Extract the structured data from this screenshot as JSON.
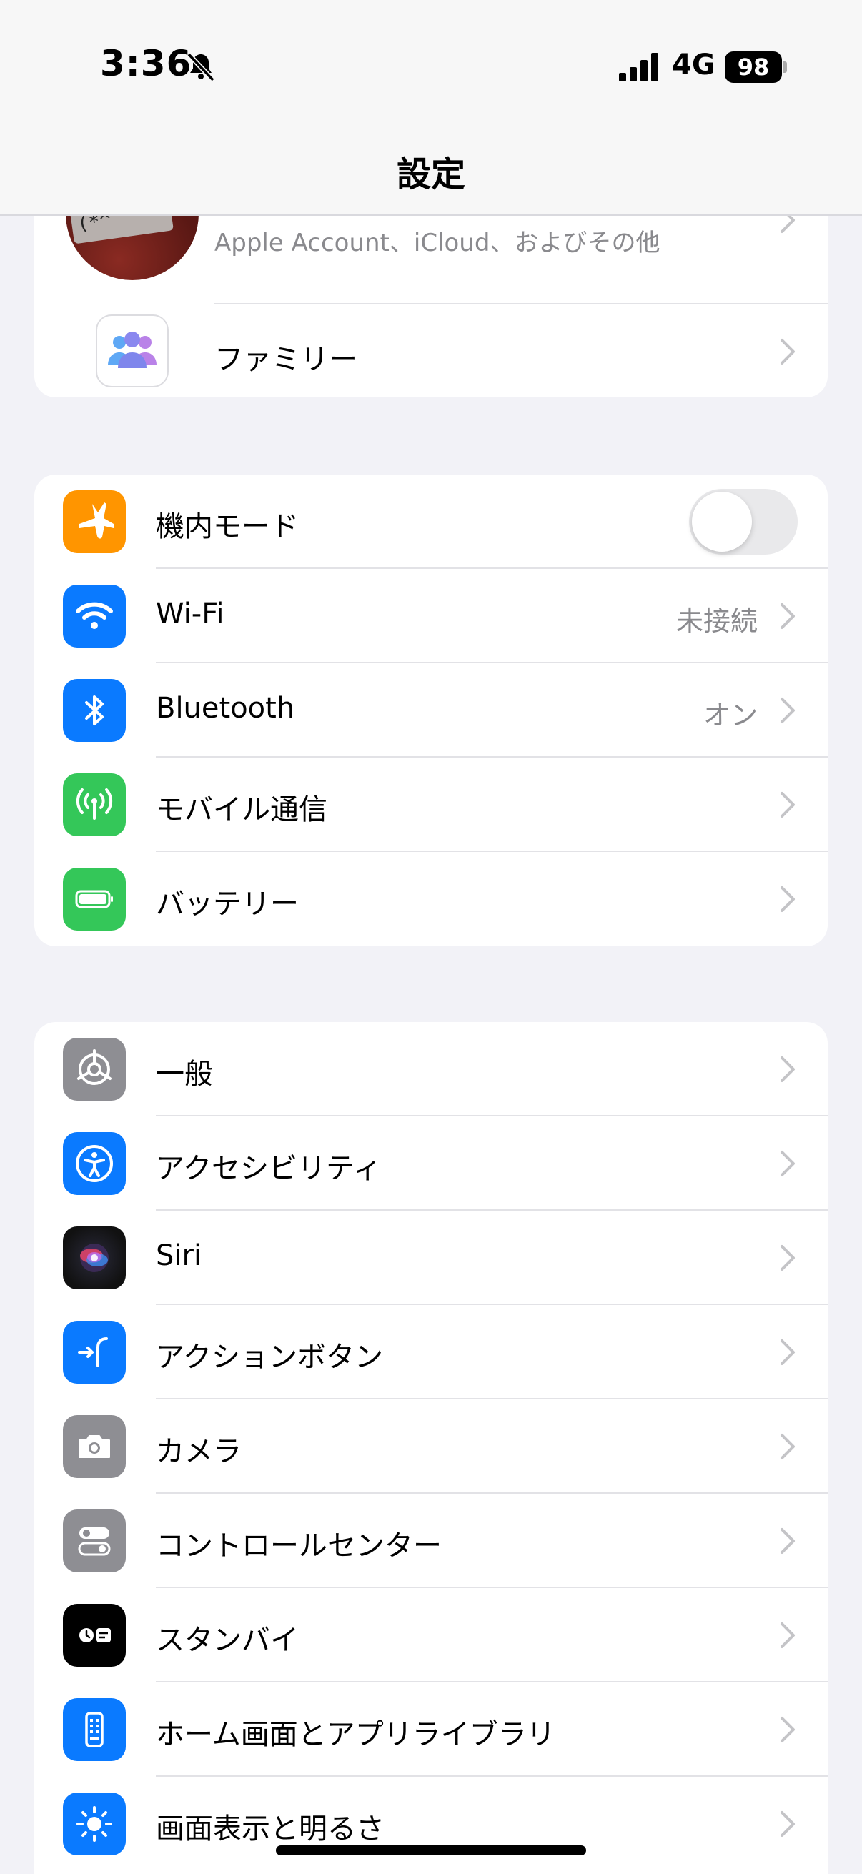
{
  "status_bar": {
    "time": "3:36",
    "network": "4G",
    "battery": "98"
  },
  "nav": {
    "title": "設定"
  },
  "account": {
    "subtitle": "Apple Account、iCloud、およびその他",
    "family_label": "ファミリー"
  },
  "connectivity": {
    "airplane_label": "機内モード",
    "airplane_on": false,
    "wifi_label": "Wi-Fi",
    "wifi_value": "未接続",
    "bluetooth_label": "Bluetooth",
    "bluetooth_value": "オン",
    "cellular_label": "モバイル通信",
    "battery_label": "バッテリー"
  },
  "general_items": [
    {
      "label": "一般",
      "icon": "gear-icon",
      "color": "#8e8e93"
    },
    {
      "label": "アクセシビリティ",
      "icon": "accessibility-icon",
      "color": "#0a7aff"
    },
    {
      "label": "Siri",
      "icon": "siri-icon",
      "color": "#1c1c1e"
    },
    {
      "label": "アクションボタン",
      "icon": "action-button-icon",
      "color": "#0a7aff"
    },
    {
      "label": "カメラ",
      "icon": "camera-icon",
      "color": "#8e8e93"
    },
    {
      "label": "コントロールセンター",
      "icon": "control-center-icon",
      "color": "#8e8e93"
    },
    {
      "label": "スタンバイ",
      "icon": "standby-icon",
      "color": "#000000"
    },
    {
      "label": "ホーム画面とアプリライブラリ",
      "icon": "home-screen-icon",
      "color": "#0a7aff"
    },
    {
      "label": "画面表示と明るさ",
      "icon": "brightness-icon",
      "color": "#0a7aff"
    }
  ]
}
